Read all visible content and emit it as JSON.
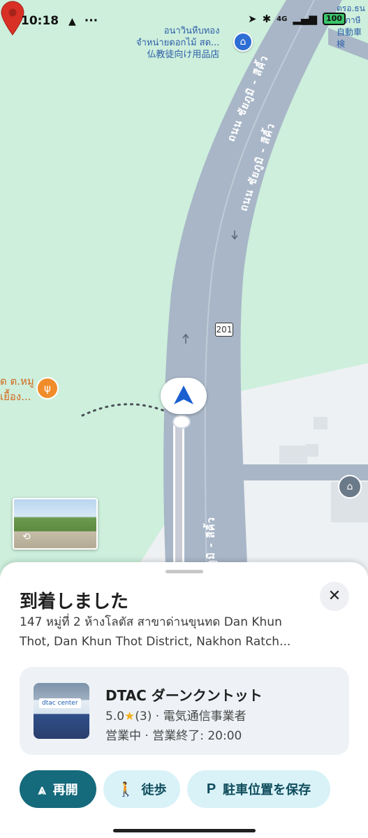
{
  "status_bar": {
    "time": "10:18",
    "nav_glyph": "▲",
    "dots": "···",
    "network": "4G",
    "battery": "100"
  },
  "map": {
    "poi_top_line1": "อนาวินหีบทอง",
    "poi_top_line2": "จำหน่ายดอกไม้ สด...",
    "poi_top_line3": "仏教徒向け用品店",
    "poi_top_right": "ตรอ.ธน",
    "poi_top_right2": "ภาษี",
    "poi_top_right3": "自動車検",
    "road_name_1": "ถนน ชัยภูมิ - สีคิ้ว",
    "road_name_2": "ถนน ชัยภูมิ - สีคิ้ว",
    "road_name_3": "ภูมิ - สีคิ้ว",
    "route_shield": "201",
    "restaurant_line1": "ด ต.หมู",
    "restaurant_line2": "เยื้อง...",
    "icons": {
      "shop": "shopping-bag-icon",
      "restaurant": "fork-knife-icon",
      "government": "government-building-icon",
      "street_view": "street-view-rotate-icon"
    }
  },
  "sheet": {
    "title": "到着しました",
    "close_glyph": "✕",
    "address": "147 หมู่ที่ 2 ห้างโลตัส สาขาด่านขุนทด Dan Khun Thot, Dan Khun Thot District, Nakhon Ratch...",
    "place": {
      "name": "DTAC ダーンクントット",
      "rating": "5.0",
      "star": "★",
      "review_count": "(3)",
      "category": "電気通信事業者",
      "status": "営業中",
      "hours": "営業終了: 20:00",
      "image_sign": "dtac center"
    },
    "buttons": {
      "resume": "再開",
      "walk": "徒歩",
      "save_parking": "駐車位置を保存"
    }
  },
  "colors": {
    "map_bg": "#cdefdc",
    "road": "#a8b6c7",
    "primary_button": "#156a7c",
    "secondary_button": "#d8f2f8",
    "nav_arrow": "#1a5fd0",
    "pin": "#d93025"
  }
}
